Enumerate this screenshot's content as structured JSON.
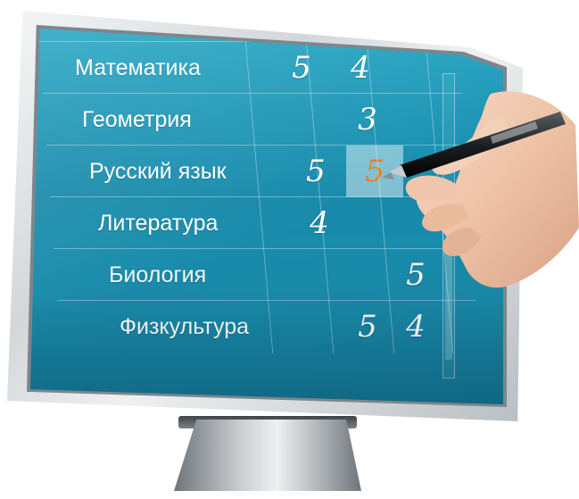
{
  "gradebook": {
    "rows": [
      {
        "subject": "Математика",
        "grades": [
          "5",
          "4",
          "",
          ""
        ]
      },
      {
        "subject": "Геометрия",
        "grades": [
          "",
          "3",
          "",
          ""
        ]
      },
      {
        "subject": "Русский язык",
        "grades": [
          "5",
          "5",
          "",
          ""
        ]
      },
      {
        "subject": "Литература",
        "grades": [
          "4",
          "",
          "",
          ""
        ]
      },
      {
        "subject": "Биология",
        "grades": [
          "",
          "",
          "5",
          ""
        ]
      },
      {
        "subject": "Физкультура",
        "grades": [
          "5",
          "4",
          "",
          ""
        ]
      }
    ],
    "highlighted_cell": {
      "row": 2,
      "col": 1
    }
  },
  "colors": {
    "screen": "#1789aa",
    "highlight_grade": "#e77b22",
    "grade_text": "#ffffff"
  },
  "icons": {
    "pen": "pen-icon",
    "hand": "hand-icon"
  }
}
